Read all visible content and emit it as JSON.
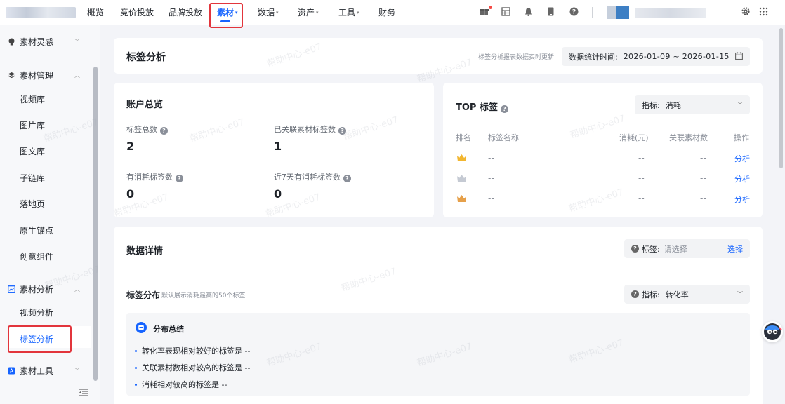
{
  "nav": {
    "items": [
      {
        "label": "概览",
        "dropdown": false
      },
      {
        "label": "竞价投放",
        "dropdown": false
      },
      {
        "label": "品牌投放",
        "dropdown": false
      },
      {
        "label": "素材",
        "dropdown": true,
        "active": true
      },
      {
        "label": "数据",
        "dropdown": true
      },
      {
        "label": "资产",
        "dropdown": true
      },
      {
        "label": "工具",
        "dropdown": true
      },
      {
        "label": "财务",
        "dropdown": false
      }
    ],
    "caret": "▾",
    "right_icons": [
      "gift-icon",
      "table-icon",
      "bell-icon",
      "mobile-icon",
      "help-icon",
      "settings-icon",
      "apps-grid-icon"
    ]
  },
  "sidebar": {
    "groups": [
      {
        "label": "素材灵感",
        "icon": "bulb-icon",
        "expanded": false,
        "items": []
      },
      {
        "label": "素材管理",
        "icon": "layers-icon",
        "expanded": true,
        "items": [
          "视频库",
          "图片库",
          "图文库",
          "子链库",
          "落地页",
          "原生锚点",
          "创意组件"
        ]
      },
      {
        "label": "素材分析",
        "icon": "analysis-icon",
        "expanded": true,
        "items": [
          "视频分析",
          "标签分析"
        ]
      },
      {
        "label": "素材工具",
        "icon": "tool-icon",
        "expanded": false,
        "items": []
      }
    ],
    "active_item": "标签分析"
  },
  "header": {
    "title": "标签分析",
    "realtime_note": "标签分析报表数据实时更新",
    "date_label": "数据统计时间:",
    "date_range": "2026-01-09 ~ 2026-01-15"
  },
  "overview": {
    "title": "账户总览",
    "stats": [
      {
        "label": "标签总数",
        "value": "2"
      },
      {
        "label": "已关联素材标签数",
        "value": "1"
      },
      {
        "label": "有消耗标签数",
        "value": "0"
      },
      {
        "label": "近7天有消耗标签数",
        "value": "0"
      }
    ]
  },
  "top_tags": {
    "title": "TOP 标签",
    "metric_label": "指标:",
    "metric_value": "消耗",
    "columns": [
      "排名",
      "标签名称",
      "消耗(元)",
      "关联素材数",
      "操作"
    ],
    "rows": [
      {
        "rank": "gold-crown",
        "name": "--",
        "cost": "--",
        "materials": "--",
        "action": "分析"
      },
      {
        "rank": "silver-crown",
        "name": "--",
        "cost": "--",
        "materials": "--",
        "action": "分析"
      },
      {
        "rank": "bronze-crown",
        "name": "--",
        "cost": "--",
        "materials": "--",
        "action": "分析"
      }
    ]
  },
  "details": {
    "title": "数据详情",
    "tag_filter_label": "标签:",
    "tag_filter_placeholder": "请选择",
    "select_label": "选择",
    "distribution_title": "标签分布",
    "distribution_note": "默认展示消耗最高的50个标签",
    "metric_label": "指标:",
    "metric_value": "转化率",
    "summary_title": "分布总结",
    "summary_items": [
      "转化率表现相对较好的标签是 --",
      "关联素材数相对较高的标签是 --",
      "消耗相对较高的标签是 --"
    ]
  },
  "watermark": "帮助中心-e07",
  "colors": {
    "accent": "#1664ff",
    "highlight_box": "#e2353c",
    "background": "#f3f4f8"
  }
}
